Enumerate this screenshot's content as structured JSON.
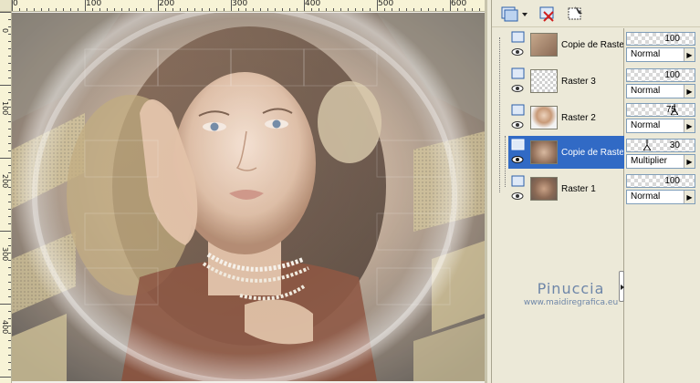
{
  "ruler": {
    "top_ticks": [
      "0",
      "100",
      "200",
      "300",
      "400",
      "500",
      "600"
    ],
    "left_ticks": [
      "0",
      "100",
      "200",
      "300",
      "400"
    ]
  },
  "toolbar": {
    "new_layer_icon": "new-layer-icon",
    "delete_layer_icon": "delete-layer-icon",
    "mask_icon": "mask-icon"
  },
  "layers": [
    {
      "name": "Copie de Raste",
      "opacity": "100",
      "blend": "Normal",
      "selected": false
    },
    {
      "name": "Raster 3",
      "opacity": "100",
      "blend": "Normal",
      "selected": false
    },
    {
      "name": "Raster 2",
      "opacity": "75",
      "blend": "Normal",
      "selected": false
    },
    {
      "name": "Copie de Raste",
      "opacity": "30",
      "blend": "Multiplier",
      "selected": true
    },
    {
      "name": "Raster 1",
      "opacity": "100",
      "blend": "Normal",
      "selected": false
    }
  ],
  "watermark": {
    "name": "Pinuccia",
    "url": "www.maidiregrafica.eu"
  },
  "colors": {
    "selection": "#316ac5",
    "panel_bg": "#ece9d8",
    "watermark": "#6e86a8"
  }
}
